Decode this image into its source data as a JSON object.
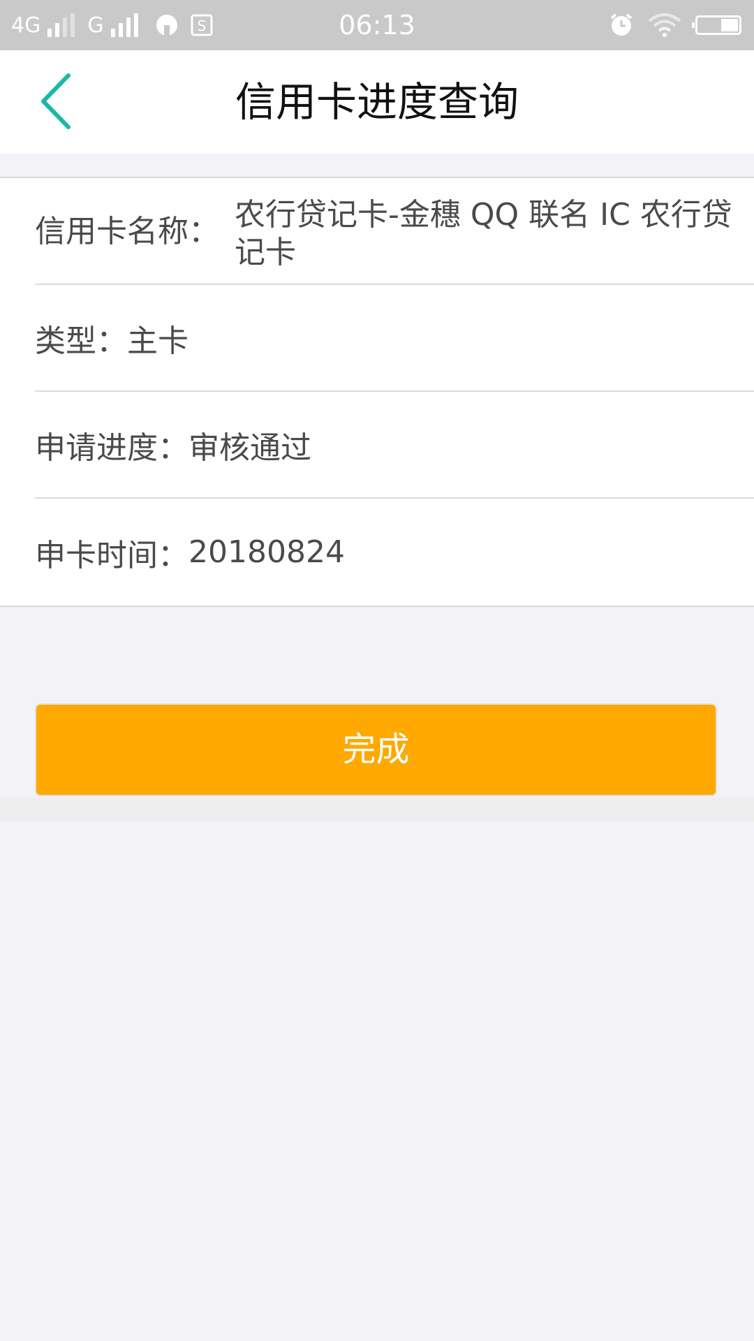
{
  "status_bar": {
    "network_1": "4G",
    "network_2": "G",
    "time": "06:13"
  },
  "header": {
    "title": "信用卡进度查询"
  },
  "info": {
    "card_name_label": "信用卡名称：",
    "card_name_value": "农行贷记卡-金穗 QQ 联名 IC 农行贷记卡",
    "type_label": "类型：",
    "type_value": "主卡",
    "progress_label": "申请进度：",
    "progress_value": "审核通过",
    "apply_time_label": "申卡时间：",
    "apply_time_value": "20180824"
  },
  "actions": {
    "done_label": "完成"
  },
  "colors": {
    "accent": "#1ab8a8",
    "button": "#ffa800"
  }
}
